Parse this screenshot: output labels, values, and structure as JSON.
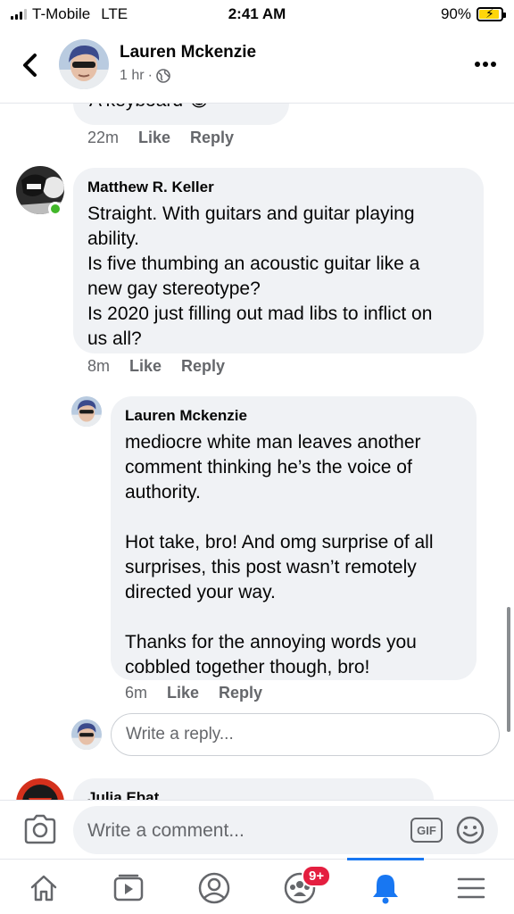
{
  "status_bar": {
    "carrier": "T-Mobile",
    "network": "LTE",
    "time": "2:41 AM",
    "battery": "90%",
    "battery_level": 0.9
  },
  "header": {
    "name": "Lauren Mckenzie",
    "time": "1 hr",
    "separator": "·",
    "privacy_icon": "globe-icon"
  },
  "comments": [
    {
      "text": "A keyboard 😂",
      "time": "22m",
      "like_label": "Like",
      "reply_label": "Reply"
    },
    {
      "author": "Matthew R. Keller",
      "text": "Straight. With guitars and guitar playing\nability.\nIs five thumbing an acoustic guitar like a\nnew gay stereotype?\nIs 2020 just filling out mad libs to inflict on\nus all?",
      "time": "8m",
      "like_label": "Like",
      "reply_label": "Reply"
    },
    {
      "author": "Lauren Mckenzie",
      "text": "mediocre white man leaves another\ncomment thinking he’s the voice of\nauthority.\n\nHot take, bro! And omg surprise of all\nsurprises, this post wasn’t remotely\ndirected your way.\n\nThanks for the annoying words you\ncobbled together though, bro!",
      "time": "6m",
      "like_label": "Like",
      "reply_label": "Reply"
    },
    {
      "author": "Julia Ebat"
    }
  ],
  "reply_input": {
    "placeholder": "Write a reply..."
  },
  "comment_bar": {
    "placeholder": "Write a comment...",
    "gif_label": "GIF"
  },
  "bottom_nav": {
    "items": [
      "home-icon",
      "watch-icon",
      "profile-icon",
      "groups-icon",
      "notifications-icon",
      "menu-icon"
    ],
    "groups_badge": "9+",
    "active": "notifications-icon"
  },
  "colors": {
    "accent": "#1877f2",
    "bubble": "#f0f2f5",
    "secondary_text": "#65676b",
    "online": "#42b72a",
    "badge": "#e41e3f"
  }
}
